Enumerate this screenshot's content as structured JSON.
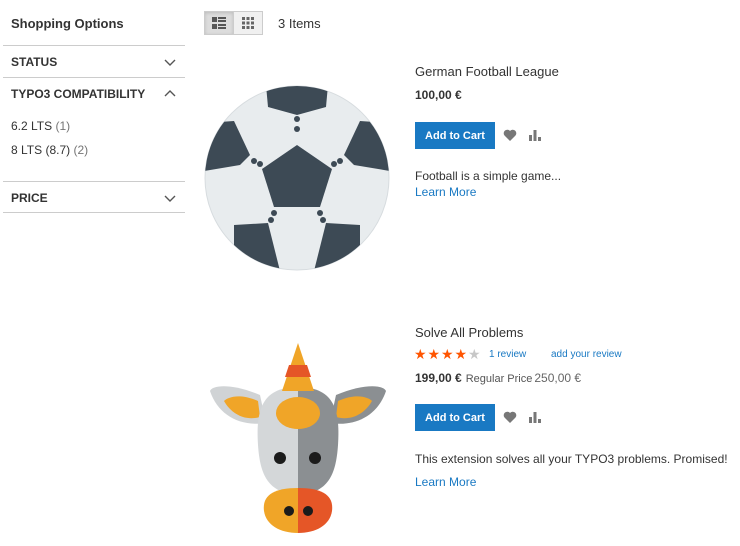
{
  "sidebar": {
    "title": "Shopping Options",
    "filters": [
      {
        "label": "STATUS",
        "expanded": false
      },
      {
        "label": "TYPO3 COMPATIBILITY",
        "expanded": true,
        "options": [
          {
            "label": "6.2 LTS",
            "count": "(1)"
          },
          {
            "label": "8 LTS (8.7)",
            "count": "(2)"
          }
        ]
      },
      {
        "label": "PRICE",
        "expanded": false
      }
    ]
  },
  "toolbar": {
    "modes": [
      "grid-view-icon",
      "list-view-icon"
    ],
    "item_count": "3 Items"
  },
  "products": [
    {
      "name": "German Football League",
      "price": "100,00 €",
      "add_to_cart": "Add to Cart",
      "description": "Football is a simple game...",
      "learn_more": "Learn More",
      "image": "soccer-ball-image"
    },
    {
      "name": "Solve All Problems",
      "rating": 4,
      "rating_max": 5,
      "reviews": "1 review",
      "add_review": "add your review",
      "price": "199,00 €",
      "regular_price_label": "Regular Price",
      "regular_price": "250,00 €",
      "add_to_cart": "Add to Cart",
      "description": "This extension solves all your TYPO3 problems. Promised!",
      "learn_more": "Learn More",
      "image": "unicorn-cow-image"
    }
  ],
  "colors": {
    "accent": "#1979c3",
    "star": "#ff5501",
    "star_empty": "#c7c7c7",
    "ball_dark": "#3d4a55",
    "ball_light": "#e8ecee"
  }
}
